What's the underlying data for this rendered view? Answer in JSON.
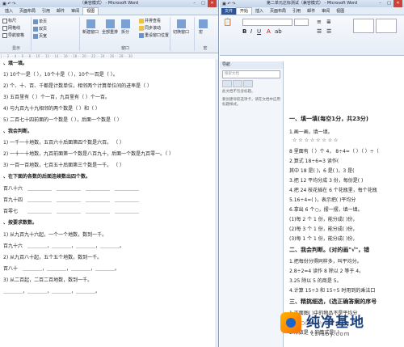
{
  "left": {
    "title": "（兼容模式） - Microsoft Word",
    "tabs": [
      "插入",
      "页面布局",
      "引用",
      "邮件",
      "审阅",
      "视图"
    ],
    "ribbon": {
      "show_items": [
        "标尺",
        "网格线",
        "导航窗格"
      ],
      "btn_onepage": "单页",
      "btn_twopage": "双页",
      "btn_pagewidth": "页宽",
      "btn_newwin": "新建窗口",
      "btn_arrange": "全部重排",
      "btn_split": "拆分",
      "side_opts": [
        "并排查看",
        "同步滚动",
        "重设窗口位置"
      ],
      "btn_switch": "切换窗口",
      "btn_macro": "宏",
      "g_show": "显示",
      "g_window": "窗口",
      "g_macro": "宏"
    },
    "doc": [
      "、填一填。",
      "1) 10个一是（    ），10个十是（    ），10个一百是（         ）。",
      "2) 个、十、百、千都是计数单位，相邻两个计算单位间的进率是（         ）",
      "3) 五百里有（    ）个一百，九百里有（    ）个一百。",
      "4) 与九百九十九相邻的两个数是（        ）和（        ）",
      "5) 二百七十四前面的一个数是（        ），后面一个数是（        ）",
      "、我会判断。",
      "1) 一千一十地数，五百六十后面第四个数是六百。            （    ）",
      "2) 一十一十地数，九百前面第一个数是八百九十，后面一个数是九百零一。（    ）",
      "3) 一百一百地数，七百五十后面第三个数是一千。            （    ）",
      "、在下面的各数的后面连续数出四个数。",
      "百八十六",
      "百九十四",
      "百零七",
      "、按要求数数。",
      "1) 从九百九十六起，一个一个地数，数到一千。",
      "百九十六",
      "2) 从九百八十起，五个五个地数，数到一千。",
      "百八十",
      "3) 从二百起，二百二百地数，数到一千。"
    ]
  },
  "right": {
    "title": "第二单元达标测试（兼容模式） - Microsoft Word",
    "tabs": [
      "文件",
      "开始",
      "插入",
      "页面布局",
      "引用",
      "邮件",
      "审阅",
      "视图"
    ],
    "nav_title": "导航",
    "nav_search": "搜索文档",
    "nav_hint1": "此文档不包含标题。",
    "nav_hint2": "要创建导航选项卡，请在文档中应用标题样式。",
    "doc": [
      "一、填一填(每空1分，共23分)",
      "1.画一画，填一填。",
      "☆ ☆ ☆ ☆ ☆ ☆ ☆ ☆",
      "8 里面有（  ）个 4，    8÷4=（  ）（  ）÷（",
      "2.算式 18÷6=3 读作(",
      "其中 18 是(    )，6 是(    )，3 是(",
      "3.把 12 平均分成 3 份，每份是(    )",
      "4.把 24 枝花插在 6 个花瓶里，每个花瓶",
      "5.16÷4=(    )，表示把(    )平均分",
      "6.拿出 6 个○，摆一摆，填一填。",
      "(1)每 2 个 1 份，能分成(      )份，",
      "(2)每 3 个 1 份，能分成(      )份，",
      "(3)每 1 个 1 份，能分成(      )份，",
      "二、我会判断。(对的画\"√\"，错",
      "1.把每份分得同样多，叫平均分。",
      "2.8÷2=4 读作 8 除以 2 等于 4。",
      "3.25 除以 5 的商是 5。",
      "4.计算 15÷3 和 15÷5 时用到的乘法口",
      "三、精挑细选，(选正确答案的序号",
      "1.下面图(    )中的物品不是平均分",
      "2.除数是 4 的算式是(    )"
    ]
  },
  "watermark": {
    "title": "纯净基地",
    "url": "czlaby.com"
  }
}
